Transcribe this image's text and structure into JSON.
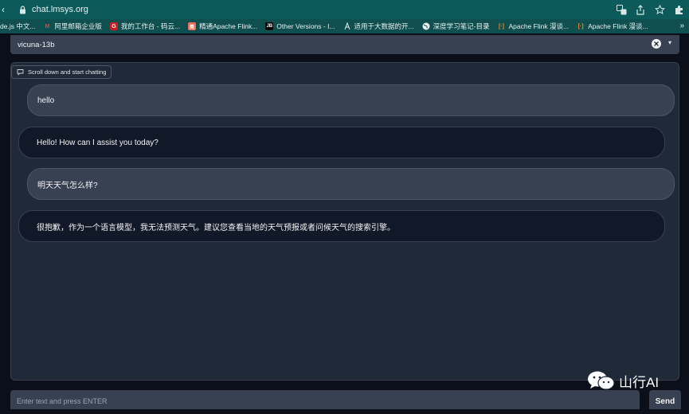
{
  "browser": {
    "url": "chat.lmsys.org",
    "back_glyph": "‹",
    "bookmarks": [
      {
        "label": "de.js 中文...",
        "icon": "",
        "color": ""
      },
      {
        "label": "阿里邮箱企业版",
        "icon": "M",
        "color": "#e04a3f"
      },
      {
        "label": "我的工作台 - 码云...",
        "icon": "G",
        "color": "#c71d23"
      },
      {
        "label": "精通Apache Flink...",
        "icon": "简",
        "color": "#ea6f5a"
      },
      {
        "label": "Other Versions - I...",
        "icon": "JB",
        "color": "#000000"
      },
      {
        "label": "适用于大数据的开...",
        "icon": "",
        "color": ""
      },
      {
        "label": "深度学习笔记-目录",
        "icon": "",
        "color": ""
      },
      {
        "label": "Apache Flink 漫谈...",
        "icon": "[·]",
        "color": "#f08c2a"
      },
      {
        "label": "Apache Flink 漫谈...",
        "icon": "[·]",
        "color": "#f08c2a"
      }
    ],
    "more": "»"
  },
  "model_selector": {
    "value": "vicuna-13b"
  },
  "chatbot": {
    "label": "Scroll down and start chatting",
    "messages": [
      {
        "role": "user",
        "text": "hello"
      },
      {
        "role": "bot",
        "text": "Hello! How can I assist you today?"
      },
      {
        "role": "user",
        "text": "明天天气怎么样?"
      },
      {
        "role": "bot",
        "text": "很抱歉，作为一个语言模型，我无法预测天气。建议您查看当地的天气预报或者问候天气的搜索引擎。"
      }
    ]
  },
  "input": {
    "placeholder": "Enter text and press ENTER",
    "value": ""
  },
  "send_button": {
    "label": "Send"
  },
  "watermark": {
    "text": "山行AI"
  }
}
